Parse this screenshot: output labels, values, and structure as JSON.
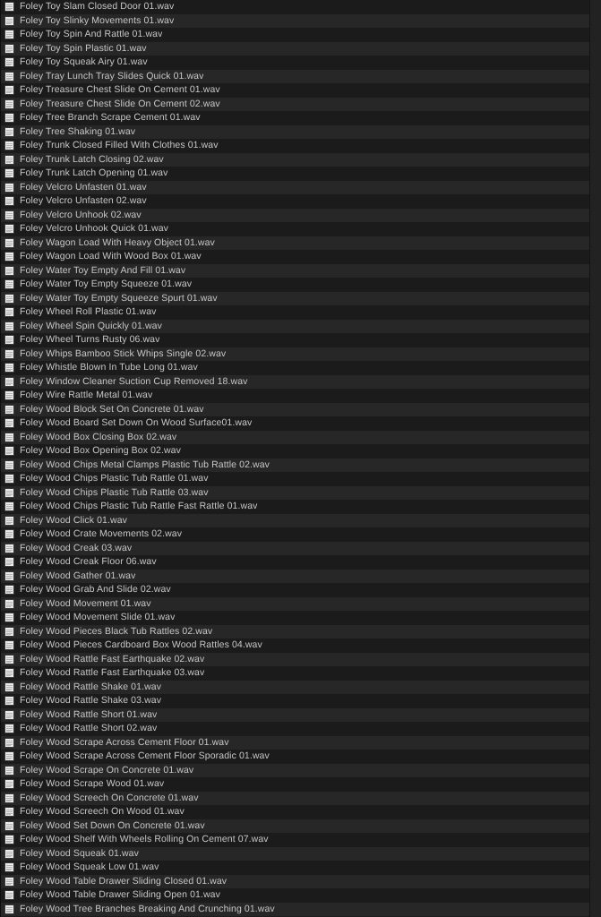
{
  "window": {
    "title": "Foley Sound Library — File List",
    "view_mode": "list",
    "colors": {
      "row_dark": "#1b1b1b",
      "row_light": "#272727",
      "text": "#c8c8c8",
      "background": "#1d1d1d",
      "divider": "#131313",
      "gutter": "#222222"
    }
  },
  "file_list": {
    "icon_name": "audio-file-icon",
    "total_visible": 66,
    "items": [
      {
        "name": "Foley Toy Slam Closed Door 01.wav"
      },
      {
        "name": "Foley Toy Slinky Movements 01.wav"
      },
      {
        "name": "Foley Toy Spin And Rattle 01.wav"
      },
      {
        "name": "Foley Toy Spin Plastic 01.wav"
      },
      {
        "name": "Foley Toy Squeak Airy 01.wav"
      },
      {
        "name": "Foley Tray Lunch Tray Slides Quick 01.wav"
      },
      {
        "name": "Foley Treasure Chest Slide On Cement 01.wav"
      },
      {
        "name": "Foley Treasure Chest Slide On Cement 02.wav"
      },
      {
        "name": "Foley Tree Branch Scrape Cement  01.wav"
      },
      {
        "name": "Foley Tree Shaking 01.wav"
      },
      {
        "name": "Foley Trunk Closed Filled With Clothes 01.wav"
      },
      {
        "name": "Foley Trunk Latch Closing 02.wav"
      },
      {
        "name": "Foley Trunk Latch Opening 01.wav"
      },
      {
        "name": "Foley Velcro Unfasten 01.wav"
      },
      {
        "name": "Foley Velcro Unfasten 02.wav"
      },
      {
        "name": "Foley Velcro Unhook 02.wav"
      },
      {
        "name": "Foley Velcro Unhook Quick 01.wav"
      },
      {
        "name": "Foley Wagon Load With Heavy Object 01.wav"
      },
      {
        "name": "Foley Wagon Load With Wood Box 01.wav"
      },
      {
        "name": "Foley Water Toy Empty And Fill 01.wav"
      },
      {
        "name": "Foley Water Toy Empty Squeeze 01.wav"
      },
      {
        "name": "Foley Water Toy Empty Squeeze Spurt 01.wav"
      },
      {
        "name": "Foley Wheel Roll Plastic 01.wav"
      },
      {
        "name": "Foley Wheel Spin Quickly 01.wav"
      },
      {
        "name": "Foley Wheel Turns Rusty 06.wav"
      },
      {
        "name": "Foley Whips Bamboo Stick Whips Single 02.wav"
      },
      {
        "name": "Foley Whistle Blown In Tube Long 01.wav"
      },
      {
        "name": "Foley Window Cleaner Suction Cup Removed 18.wav"
      },
      {
        "name": "Foley Wire Rattle Metal 01.wav"
      },
      {
        "name": "Foley Wood Block Set On Concrete 01.wav"
      },
      {
        "name": "Foley Wood Board Set Down On Wood Surface01.wav"
      },
      {
        "name": "Foley Wood Box Closing Box 02.wav"
      },
      {
        "name": "Foley Wood Box Opening Box 02.wav"
      },
      {
        "name": "Foley Wood Chips Metal Clamps Plastic Tub Rattle 02.wav"
      },
      {
        "name": "Foley Wood Chips Plastic Tub Rattle 01.wav"
      },
      {
        "name": "Foley Wood Chips Plastic Tub Rattle 03.wav"
      },
      {
        "name": "Foley Wood Chips Plastic Tub Rattle Fast Rattle 01.wav"
      },
      {
        "name": "Foley Wood Click 01.wav"
      },
      {
        "name": "Foley Wood Crate Movements 02.wav"
      },
      {
        "name": "Foley Wood Creak 03.wav"
      },
      {
        "name": "Foley Wood Creak Floor 06.wav"
      },
      {
        "name": "Foley Wood Gather 01.wav"
      },
      {
        "name": "Foley Wood Grab And Slide 02.wav"
      },
      {
        "name": "Foley Wood Movement 01.wav"
      },
      {
        "name": "Foley Wood Movement Slide 01.wav"
      },
      {
        "name": "Foley Wood Pieces Black Tub Rattles 02.wav"
      },
      {
        "name": "Foley Wood Pieces Cardboard Box Wood Rattles 04.wav"
      },
      {
        "name": "Foley Wood Rattle Fast Earthquake 02.wav"
      },
      {
        "name": "Foley Wood Rattle Fast Earthquake 03.wav"
      },
      {
        "name": "Foley Wood Rattle Shake 01.wav"
      },
      {
        "name": "Foley Wood Rattle Shake 03.wav"
      },
      {
        "name": "Foley Wood Rattle Short 01.wav"
      },
      {
        "name": "Foley Wood Rattle Short 02.wav"
      },
      {
        "name": "Foley Wood Scrape Across Cement Floor 01.wav"
      },
      {
        "name": "Foley Wood Scrape Across Cement Floor Sporadic 01.wav"
      },
      {
        "name": "Foley Wood Scrape On Concrete 01.wav"
      },
      {
        "name": "Foley Wood Scrape Wood 01.wav"
      },
      {
        "name": "Foley Wood Screech On Concrete 01.wav"
      },
      {
        "name": "Foley Wood Screech On Wood 01.wav"
      },
      {
        "name": "Foley Wood Set Down On Concrete 01.wav"
      },
      {
        "name": "Foley Wood Shelf With Wheels Rolling On Cement 07.wav"
      },
      {
        "name": "Foley Wood Squeak 01.wav"
      },
      {
        "name": "Foley Wood Squeak Low 01.wav"
      },
      {
        "name": "Foley Wood Table Drawer Sliding Closed 01.wav"
      },
      {
        "name": "Foley Wood Table Drawer Sliding Open 01.wav"
      },
      {
        "name": "Foley Wood Tree Branches Breaking And Crunching 01.wav"
      }
    ]
  }
}
